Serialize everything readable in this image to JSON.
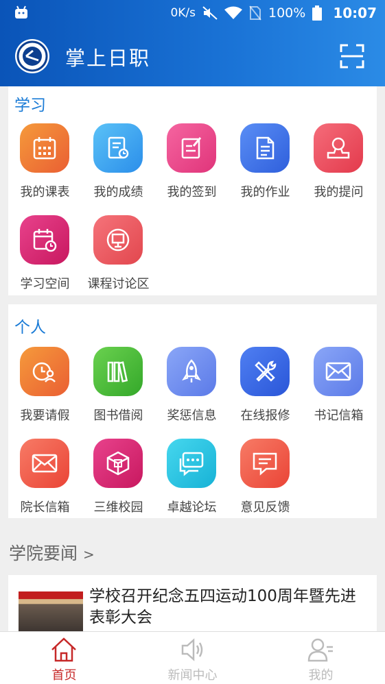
{
  "status_bar": {
    "speed": "0K/s",
    "battery": "100%",
    "time": "10:07"
  },
  "header": {
    "title": "掌上日职"
  },
  "study": {
    "title": "学习",
    "items": [
      {
        "label": "我的课表",
        "icon": "calendar-icon",
        "color": "#f07a35"
      },
      {
        "label": "我的成绩",
        "icon": "grade-icon",
        "color": "#3fa8f0"
      },
      {
        "label": "我的签到",
        "icon": "sign-in-icon",
        "color": "#ec4a8a"
      },
      {
        "label": "我的作业",
        "icon": "homework-icon",
        "color": "#3d74e8"
      },
      {
        "label": "我的提问",
        "icon": "question-icon",
        "color": "#ec4a5e"
      },
      {
        "label": "学习空间",
        "icon": "study-space-icon",
        "color": "#d9276f"
      },
      {
        "label": "课程讨论区",
        "icon": "course-discussion-icon",
        "color": "#ec5a5a"
      }
    ]
  },
  "personal": {
    "title": "个人",
    "items": [
      {
        "label": "我要请假",
        "icon": "leave-icon",
        "color": "#f07a35"
      },
      {
        "label": "图书借阅",
        "icon": "books-icon",
        "color": "#4fbf3a"
      },
      {
        "label": "奖惩信息",
        "icon": "rocket-icon",
        "color": "#6f8ef0"
      },
      {
        "label": "在线报修",
        "icon": "repair-icon",
        "color": "#3d6ee8"
      },
      {
        "label": "书记信箱",
        "icon": "mail-icon",
        "color": "#6f8ef0"
      },
      {
        "label": "院长信箱",
        "icon": "mail-icon",
        "color": "#f0584a"
      },
      {
        "label": "三维校园",
        "icon": "cube-icon",
        "color": "#d9276f"
      },
      {
        "label": "卓越论坛",
        "icon": "forum-icon",
        "color": "#28c4e0"
      },
      {
        "label": "意见反馈",
        "icon": "feedback-icon",
        "color": "#f0584a"
      }
    ]
  },
  "news": {
    "heading": "学院要闻",
    "arrow": ">",
    "items": [
      {
        "title": "学校召开纪念五四运动100周年暨先进表彰大会"
      }
    ]
  },
  "bottom_nav": [
    {
      "label": "首页",
      "icon": "home-icon",
      "active": true
    },
    {
      "label": "新闻中心",
      "icon": "speaker-icon",
      "active": false
    },
    {
      "label": "我的",
      "icon": "profile-icon",
      "active": false
    }
  ],
  "colors": {
    "accent": "#1a7bd6",
    "active_tab": "#c62828",
    "header": "#1565c0"
  }
}
